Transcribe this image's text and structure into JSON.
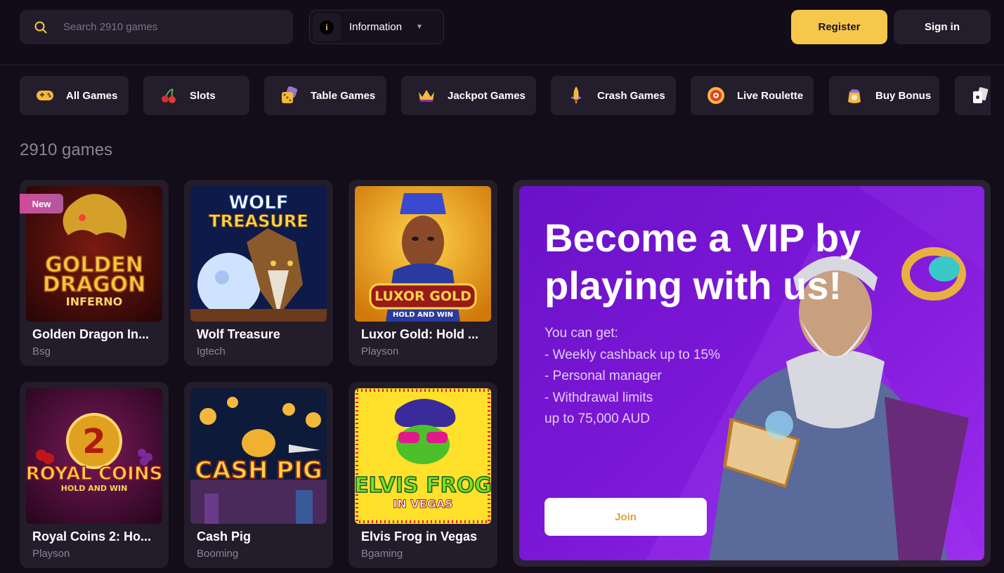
{
  "header": {
    "search_placeholder": "Search 2910 games",
    "info_label": "Information",
    "register_label": "Register",
    "signin_label": "Sign in"
  },
  "categories": [
    {
      "label": "All Games",
      "icon": "gamepad-icon"
    },
    {
      "label": "Slots",
      "icon": "cherries-icon"
    },
    {
      "label": "Table Games",
      "icon": "dice-icon"
    },
    {
      "label": "Jackpot Games",
      "icon": "crown-icon"
    },
    {
      "label": "Crash Games",
      "icon": "rocket-icon"
    },
    {
      "label": "Live Roulette",
      "icon": "roulette-icon"
    },
    {
      "label": "Buy Bonus",
      "icon": "bonus-bag-icon"
    },
    {
      "label": "",
      "icon": "cards-icon"
    }
  ],
  "games_count_title": "2910 games",
  "games": [
    {
      "name": "Golden Dragon In...",
      "provider": "Bsg",
      "thumb_title": "GOLDEN DRAGON INFERNO",
      "badge": "New"
    },
    {
      "name": "Wolf Treasure",
      "provider": "Igtech",
      "thumb_title": "WOLF TREASURE"
    },
    {
      "name": "Luxor Gold: Hold ...",
      "provider": "Playson",
      "thumb_title": "LUXOR GOLD",
      "thumb_sub": "HOLD AND WIN"
    },
    {
      "name": "Royal Coins 2: Ho...",
      "provider": "Playson",
      "thumb_title": "ROYAL COINS",
      "thumb_sub": "HOLD AND WIN"
    },
    {
      "name": "Cash Pig",
      "provider": "Booming",
      "thumb_title": "CASH PIG"
    },
    {
      "name": "Elvis Frog in Vegas",
      "provider": "Bgaming",
      "thumb_title": "ELVIS FROG",
      "thumb_sub": "IN VEGAS"
    }
  ],
  "vip": {
    "headline": "Become a VIP by playing with us!",
    "list": [
      "You can get:",
      "- Weekly cashback up to 15%",
      "- Personal manager",
      "- Withdrawal limits",
      "up to 75,000 AUD"
    ],
    "join_label": "Join"
  },
  "colors": {
    "accent": "#f5c84b",
    "background": "#120d19",
    "card": "#221c2b",
    "vip_purple": "#7b17d6"
  }
}
